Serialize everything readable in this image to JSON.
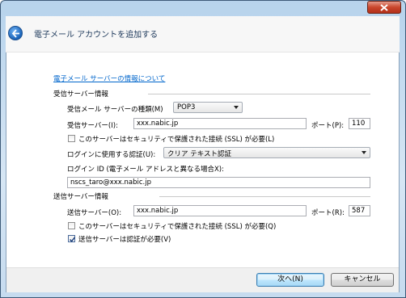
{
  "window": {
    "title": "電子メール アカウントを追加する"
  },
  "content": {
    "link_text": "電子メール サーバーの情報について",
    "incoming": {
      "section_label": "受信サーバー情報",
      "type_label": "受信メール サーバーの種類(M)",
      "type_value": "POP3",
      "server_label": "受信サーバー(I):",
      "server_value": "xxx.nabic.jp",
      "port_label": "ポート(P):",
      "port_value": "110",
      "ssl_label": "このサーバーはセキュリティで保護された接続 (SSL) が必要(L)",
      "ssl_checked": false,
      "auth_label": "ログインに使用する認証(U):",
      "auth_value": "クリア テキスト認証",
      "login_id_label": "ログイン ID (電子メール アドレスと異なる場合X):",
      "login_id_value": "nscs_taro@xxx.nabic.jp"
    },
    "outgoing": {
      "section_label": "送信サーバー情報",
      "server_label": "送信サーバー(O):",
      "server_value": "xxx.nabic.jp",
      "port_label": "ポート(R):",
      "port_value": "587",
      "ssl_label": "このサーバーはセキュリティで保護された接続 (SSL) が必要(Q)",
      "ssl_checked": false,
      "auth_required_label": "送信サーバーは認証が必要(V)",
      "auth_required_checked": true
    }
  },
  "footer": {
    "next_label": "次へ(N)",
    "cancel_label": "キャンセル"
  }
}
